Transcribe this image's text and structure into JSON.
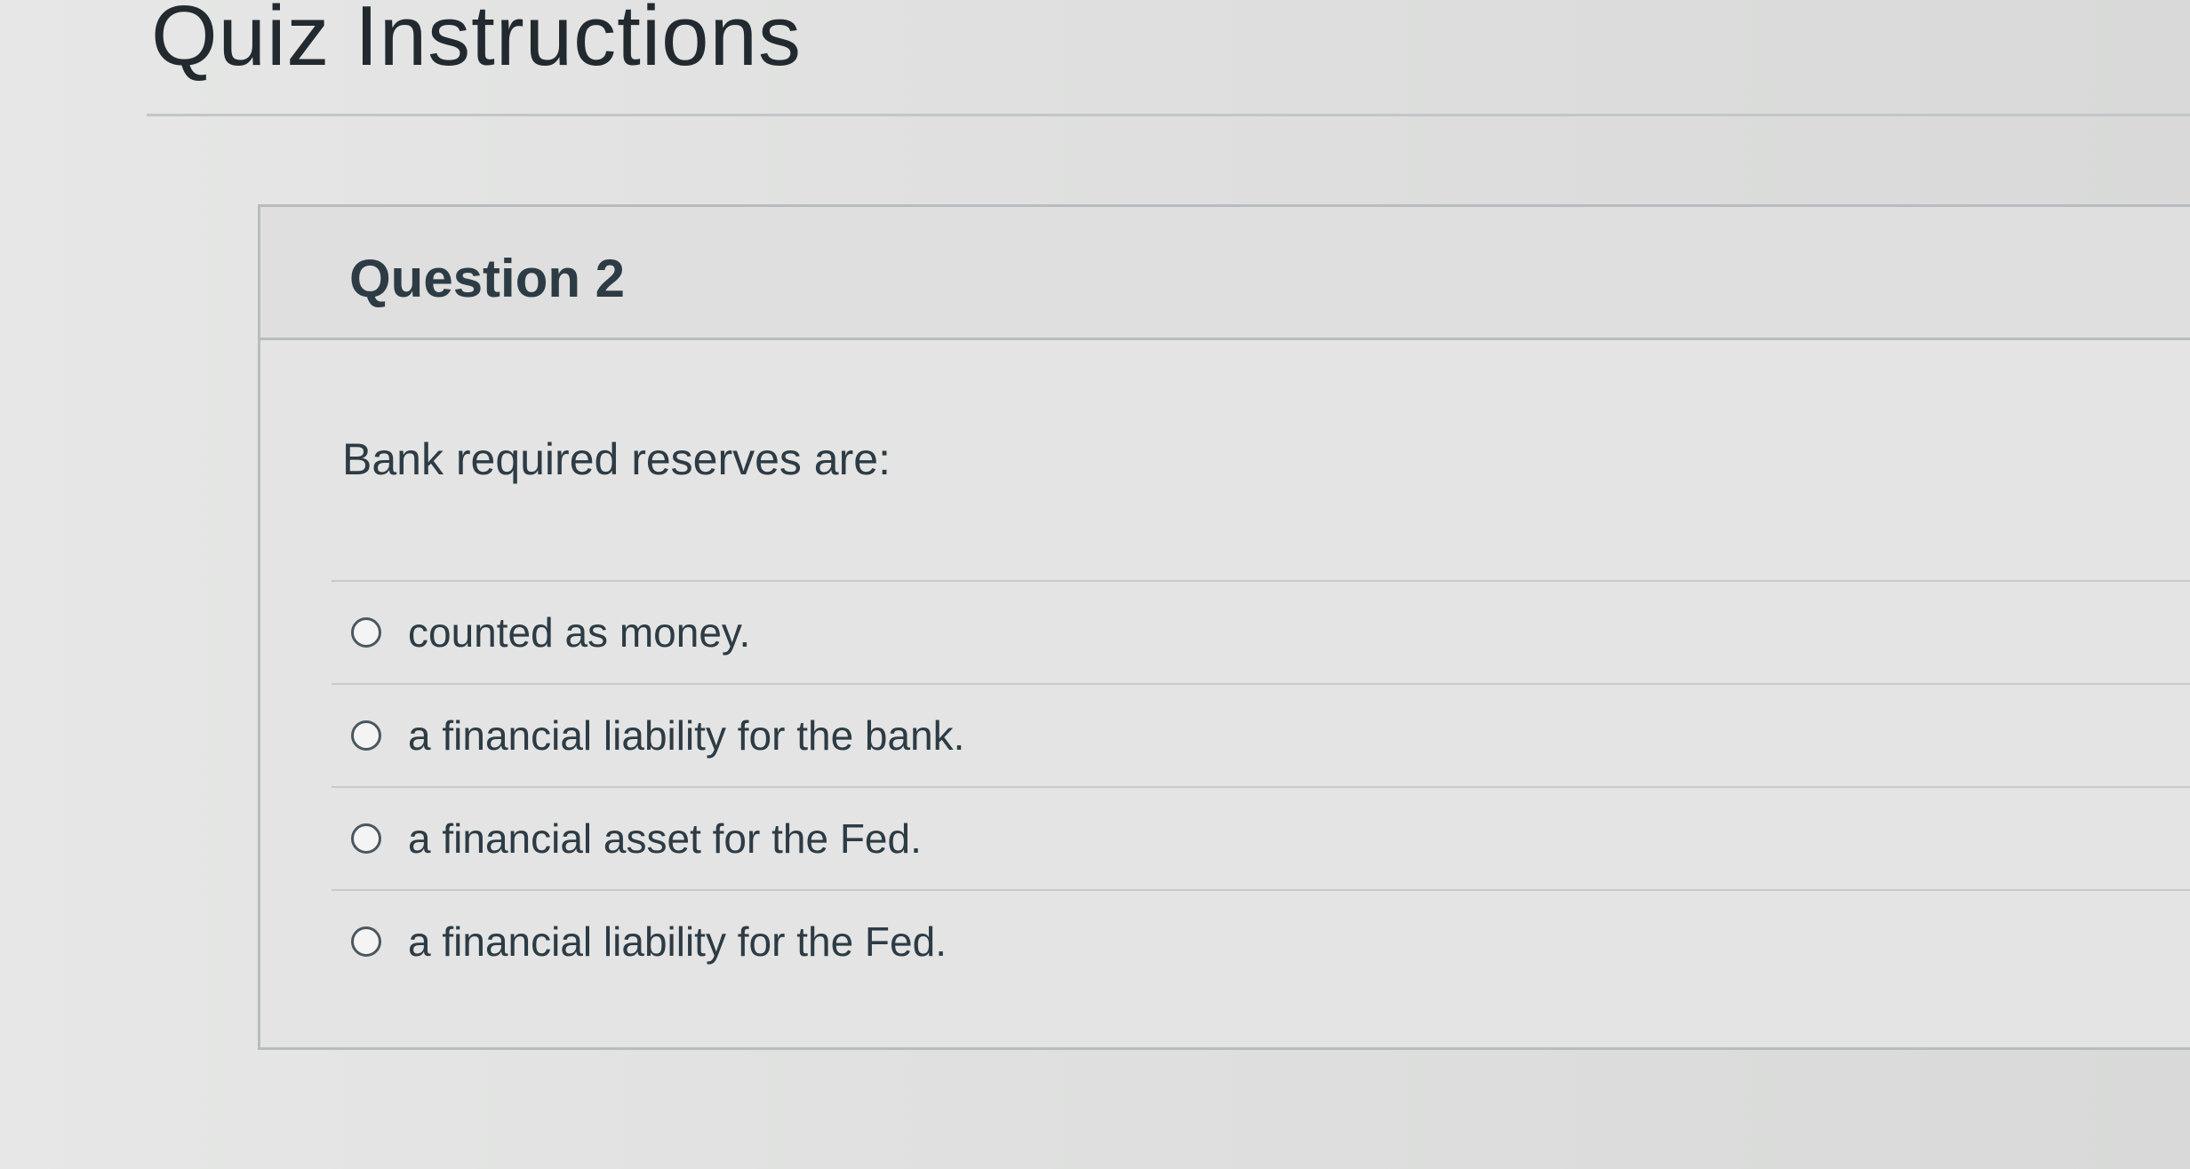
{
  "page": {
    "title": "Quiz Instructions"
  },
  "question": {
    "label": "Question 2",
    "prompt": "Bank required reserves are:",
    "answers": [
      {
        "label": "counted as money."
      },
      {
        "label": "a financial liability for the bank."
      },
      {
        "label": "a financial asset for the Fed."
      },
      {
        "label": "a financial liability for the Fed."
      }
    ]
  },
  "colors": {
    "text": "#2d3b45",
    "border": "#b8bcbf",
    "background": "#e3e4e3"
  }
}
